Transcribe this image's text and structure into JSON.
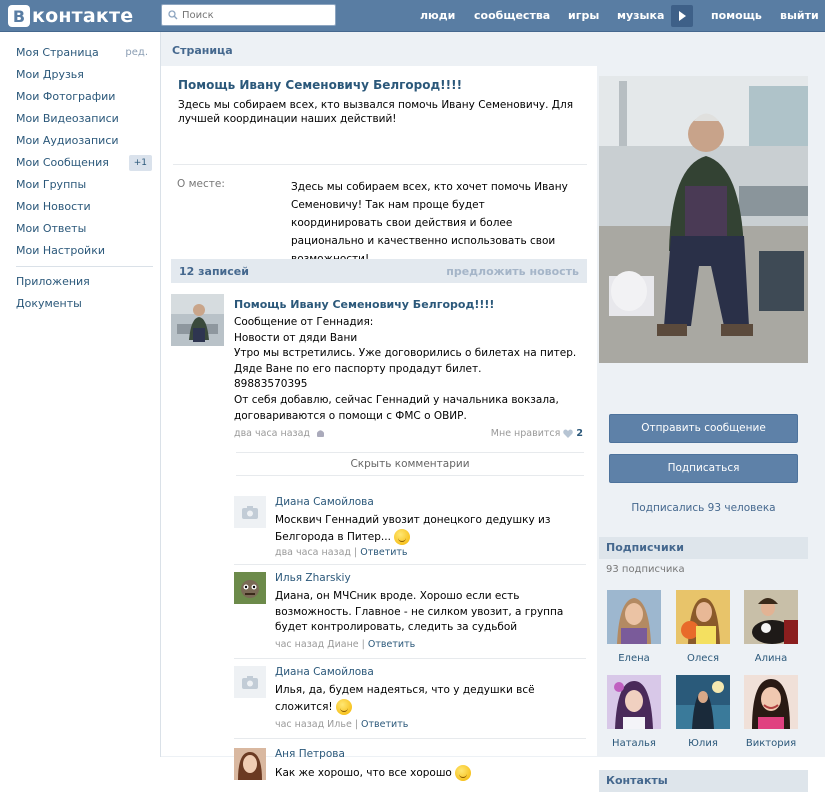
{
  "header": {
    "logo_letter": "B",
    "logo_text": "контакте",
    "search_placeholder": "Поиск",
    "nav": [
      "люди",
      "сообщества",
      "игры",
      "музыка",
      "помощь",
      "выйти"
    ]
  },
  "leftnav": {
    "items": [
      {
        "label": "Моя Страница",
        "extra": "ред."
      },
      {
        "label": "Мои Друзья"
      },
      {
        "label": "Мои Фотографии"
      },
      {
        "label": "Мои Видеозаписи"
      },
      {
        "label": "Мои Аудиозаписи"
      },
      {
        "label": "Мои Сообщения",
        "badge": "+1"
      },
      {
        "label": "Мои Группы"
      },
      {
        "label": "Мои Новости"
      },
      {
        "label": "Мои Ответы"
      },
      {
        "label": "Мои Настройки"
      }
    ],
    "extra_items": [
      "Приложения",
      "Документы"
    ]
  },
  "breadcrumb": "Страница",
  "group": {
    "name": "Помощь Ивану Семеновичу Белгород!!!!",
    "description": "Здесь мы собираем всех, кто вызвался помочь Ивану Семеновичу. Для лучшей координации наших действий!",
    "info_label": "О месте:",
    "info_value": "Здесь мы собираем всех, кто хочет помочь Ивану Семеновичу! Так нам проще будет координировать свои действия и более рационально и качественно использовать свои возможности!"
  },
  "wall": {
    "count": "12 записей",
    "suggest": "предложить новость"
  },
  "post": {
    "author": "Помощь Ивану Семеновичу Белгород!!!!",
    "text": "Сообщение от Геннадия:\nНовости от дяди Вани\nУтро мы встретились. Уже договорились о билетах на питер.\nДяде Ване по его паспорту продадут билет.\n89883570395\nОт себя добавлю, сейчас Геннадий у начальника вокзала,\nдоговариваются о помощи с ФМС о ОВИР.",
    "time": "два часа назад",
    "likes_label": "Мне нравится",
    "likes_count": "2"
  },
  "hide_comments": "Скрыть комментарии",
  "comments": [
    {
      "name": "Диана Самойлова",
      "text": "Москвич Геннадий увозит донецкого дедушку из Белгорода в Питер... ",
      "time": "два часа назад",
      "reply": "Ответить"
    },
    {
      "name": "Илья Zharskiy",
      "text": "Диана, он МЧСник вроде. Хорошо если есть возможность. Главное - не силком увозит, а группа будет контролировать, следить за судьбой",
      "time": "час назад Диане",
      "reply": "Ответить"
    },
    {
      "name": "Диана Самойлова",
      "text": "Илья, да, будем надеяться, что у дедушки всё сложится! ",
      "time": "час назад Илье",
      "reply": "Ответить"
    },
    {
      "name": "Аня Петрова",
      "text": "Как же хорошо, что все хорошо "
    }
  ],
  "sidebar": {
    "send_message": "Отправить сообщение",
    "subscribe": "Подписаться",
    "subscribed_text": "Подписались 93 человека",
    "subscribers_title": "Подписчики",
    "subscribers_count": "93 подписчика",
    "subscribers": [
      "Елена",
      "Олеся",
      "Алина",
      "Наталья",
      "Юлия",
      "Виктория"
    ],
    "contacts_title": "Контакты"
  },
  "colors": {
    "header": "#597DA3",
    "link": "#2B587A",
    "button": "#5E81A8",
    "background": "#EDF1F5"
  }
}
